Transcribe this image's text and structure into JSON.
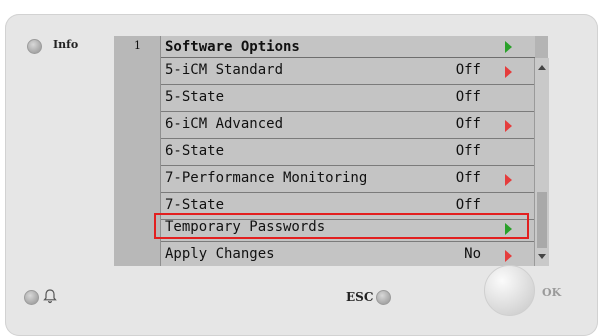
{
  "panel": {
    "info_label": "Info",
    "esc_label": "ESC",
    "ok_label": "OK"
  },
  "screen": {
    "menu_number": "1",
    "header": {
      "label": "Software Options",
      "arrow": "green"
    },
    "rows": [
      {
        "label": "5-iCM Standard",
        "value": "Off",
        "arrow": "red"
      },
      {
        "label": "5-State",
        "value": "Off",
        "arrow": ""
      },
      {
        "label": "6-iCM Advanced",
        "value": "Off",
        "arrow": "red"
      },
      {
        "label": "6-State",
        "value": "Off",
        "arrow": ""
      },
      {
        "label": "7-Performance Monitoring",
        "value": "Off",
        "arrow": "red"
      },
      {
        "label": "7-State",
        "value": "Off",
        "arrow": ""
      },
      {
        "label": "Temporary Passwords",
        "value": "",
        "arrow": "green"
      },
      {
        "label": "Apply Changes",
        "value": "No",
        "arrow": "red"
      }
    ],
    "selected_row": "Temporary Passwords"
  },
  "icons": {
    "info_led": "led-indicator-icon",
    "alarm_led": "led-indicator-icon",
    "bell": "bell-icon",
    "esc_led": "led-indicator-icon",
    "ok": "ok-button"
  },
  "colors": {
    "arrow_red": "#e53c3c",
    "arrow_green": "#2aa02a",
    "highlight": "#e21f1f",
    "screen_bg": "#c4c4c4"
  }
}
